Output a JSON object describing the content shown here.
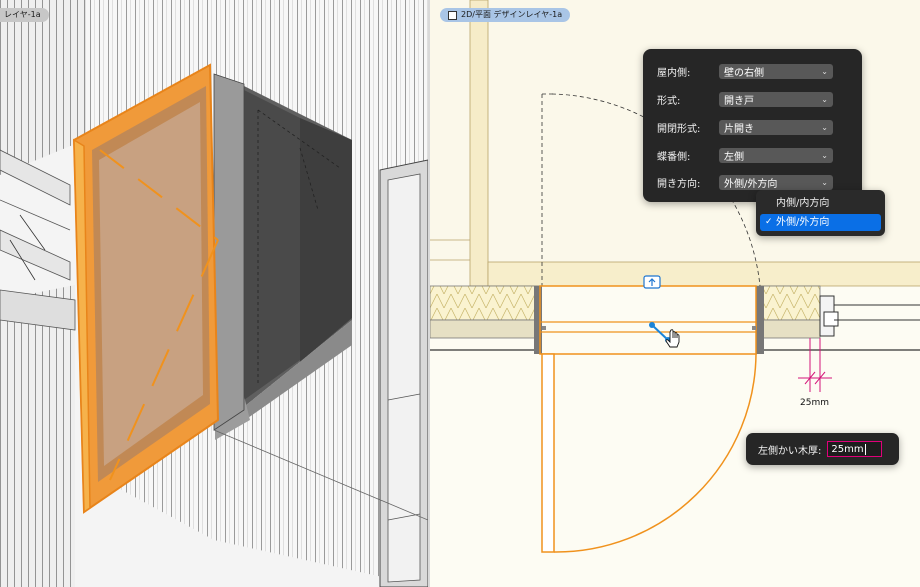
{
  "left_view": {
    "layer_badge": "レイヤ-1a",
    "door_color": "#f0921d"
  },
  "right_view": {
    "layer_badge": "2D/平面 デザインレイヤ-1a",
    "door_color": "#f0921d",
    "dimension_color": "#d4157a",
    "dimension_label": "25mm"
  },
  "door_properties": {
    "rows": [
      {
        "label": "屋内側:",
        "value": "壁の右側"
      },
      {
        "label": "形式:",
        "value": "開き戸"
      },
      {
        "label": "開閉形式:",
        "value": "片開き"
      },
      {
        "label": "蝶番側:",
        "value": "左側"
      },
      {
        "label": "開き方向:",
        "value": "外側/外方向"
      }
    ],
    "menu_options": [
      {
        "label": "内側/内方向",
        "selected": false
      },
      {
        "label": "外側/外方向",
        "selected": true
      }
    ]
  },
  "thickness_field": {
    "label": "左側かい木厚:",
    "value": "25mm"
  }
}
